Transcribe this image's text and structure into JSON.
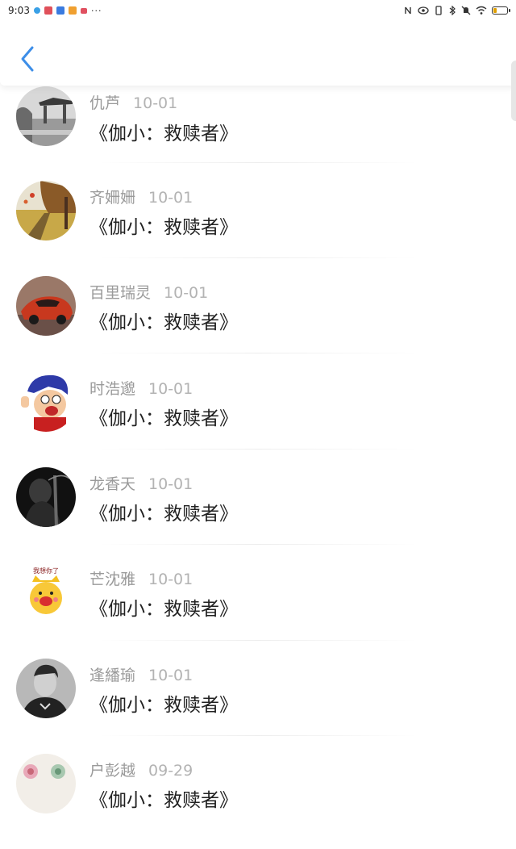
{
  "status_bar": {
    "time": "9:03",
    "overflow": "···",
    "app_icons": [
      "#39a0e6",
      "#e0505a",
      "#3a7be0",
      "#f0a030",
      "#e05060"
    ],
    "right_icons": [
      "nfc-icon",
      "eye-icon",
      "vibrate-icon",
      "bluetooth-icon",
      "mute-icon",
      "wifi-icon",
      "battery-icon"
    ]
  },
  "header": {
    "back_icon": "chevron-left-icon",
    "accent": "#3d8ee8"
  },
  "list": {
    "items": [
      {
        "name": "仇芦",
        "date": "10-01",
        "title": "《伽小：救赎者》"
      },
      {
        "name": "齐姍姍",
        "date": "10-01",
        "title": "《伽小：救赎者》"
      },
      {
        "name": "百里瑞灵",
        "date": "10-01",
        "title": "《伽小：救赎者》"
      },
      {
        "name": "时浩邈",
        "date": "10-01",
        "title": "《伽小：救赎者》"
      },
      {
        "name": "龙香天",
        "date": "10-01",
        "title": "《伽小：救赎者》"
      },
      {
        "name": "芒沈雅",
        "date": "10-01",
        "title": "《伽小：救赎者》"
      },
      {
        "name": "逢繙瑜",
        "date": "10-01",
        "title": "《伽小：救赎者》"
      },
      {
        "name": "户彭越",
        "date": "09-29",
        "title": "《伽小：救赎者》"
      }
    ]
  },
  "avatar_sticker_text": "我想你了"
}
